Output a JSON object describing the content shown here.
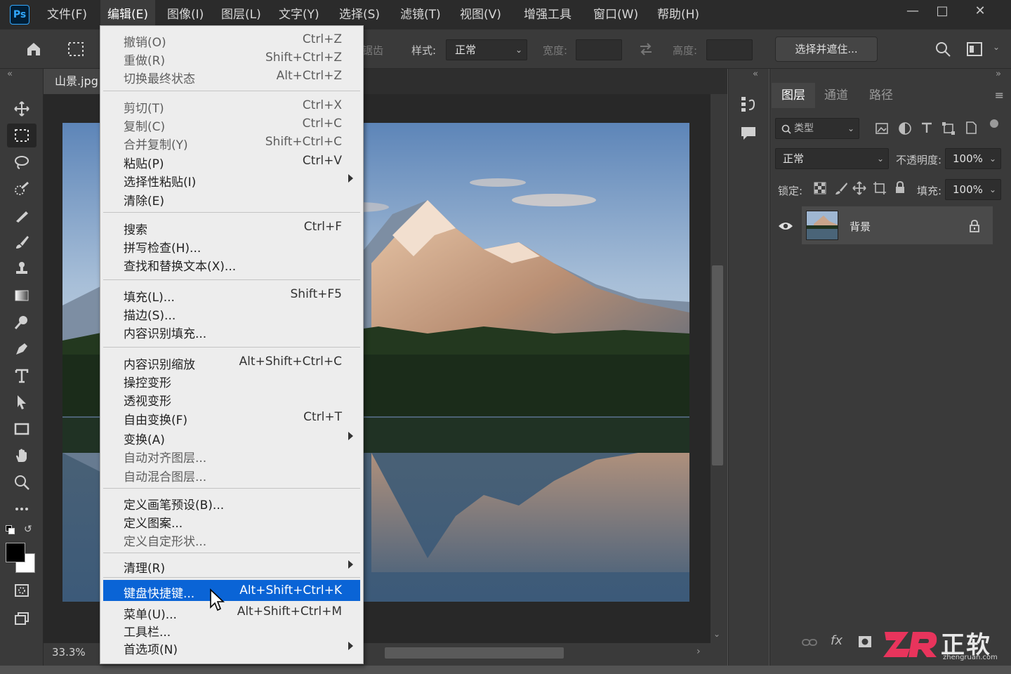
{
  "app": {
    "logo": "Ps"
  },
  "menubar": {
    "items": [
      "文件(F)",
      "编辑(E)",
      "图像(I)",
      "图层(L)",
      "文字(Y)",
      "选择(S)",
      "滤镜(T)",
      "视图(V)",
      "增强工具",
      "窗口(W)",
      "帮助(H)"
    ],
    "active_index": 1
  },
  "options_bar": {
    "style_label": "样式:",
    "style_value": "正常",
    "width_label": "宽度:",
    "height_label": "高度:",
    "partial_label": "锯齿",
    "select_mask_button": "选择并遮住..."
  },
  "document": {
    "tab_title": "山景.jpg",
    "zoom": "33.3%"
  },
  "layers_panel": {
    "tabs": [
      "图层",
      "通道",
      "路径"
    ],
    "active_tab": 0,
    "filter_placeholder": "类型",
    "blend_mode": "正常",
    "opacity_label": "不透明度:",
    "opacity_value": "100%",
    "lock_label": "锁定:",
    "fill_label": "填充:",
    "fill_value": "100%",
    "layers": [
      {
        "name": "背景",
        "locked": true,
        "visible": true
      }
    ]
  },
  "edit_menu": {
    "items": [
      {
        "label": "撤销(O)",
        "shortcut": "Ctrl+Z",
        "disabled": true
      },
      {
        "label": "重做(R)",
        "shortcut": "Shift+Ctrl+Z",
        "disabled": true
      },
      {
        "label": "切换最终状态",
        "shortcut": "Alt+Ctrl+Z",
        "disabled": true
      },
      {
        "label": "剪切(T)",
        "shortcut": "Ctrl+X",
        "disabled": true
      },
      {
        "label": "复制(C)",
        "shortcut": "Ctrl+C",
        "disabled": true
      },
      {
        "label": "合并复制(Y)",
        "shortcut": "Shift+Ctrl+C",
        "disabled": true
      },
      {
        "label": "粘贴(P)",
        "shortcut": "Ctrl+V",
        "disabled": false
      },
      {
        "label": "选择性粘贴(I)",
        "shortcut": "",
        "disabled": false,
        "submenu": true
      },
      {
        "label": "清除(E)",
        "shortcut": "",
        "disabled": false
      },
      {
        "label": "搜索",
        "shortcut": "Ctrl+F",
        "disabled": false
      },
      {
        "label": "拼写检查(H)...",
        "shortcut": "",
        "disabled": false
      },
      {
        "label": "查找和替换文本(X)...",
        "shortcut": "",
        "disabled": false
      },
      {
        "label": "填充(L)...",
        "shortcut": "Shift+F5",
        "disabled": false
      },
      {
        "label": "描边(S)...",
        "shortcut": "",
        "disabled": false
      },
      {
        "label": "内容识别填充...",
        "shortcut": "",
        "disabled": false
      },
      {
        "label": "内容识别缩放",
        "shortcut": "Alt+Shift+Ctrl+C",
        "disabled": false
      },
      {
        "label": "操控变形",
        "shortcut": "",
        "disabled": false
      },
      {
        "label": "透视变形",
        "shortcut": "",
        "disabled": false
      },
      {
        "label": "自由变换(F)",
        "shortcut": "Ctrl+T",
        "disabled": false
      },
      {
        "label": "变换(A)",
        "shortcut": "",
        "disabled": false,
        "submenu": true
      },
      {
        "label": "自动对齐图层...",
        "shortcut": "",
        "disabled": true
      },
      {
        "label": "自动混合图层...",
        "shortcut": "",
        "disabled": true
      },
      {
        "label": "定义画笔预设(B)...",
        "shortcut": "",
        "disabled": false
      },
      {
        "label": "定义图案...",
        "shortcut": "",
        "disabled": false
      },
      {
        "label": "定义自定形状...",
        "shortcut": "",
        "disabled": true
      },
      {
        "label": "清理(R)",
        "shortcut": "",
        "disabled": false,
        "submenu": true
      },
      {
        "label": "键盘快捷键...",
        "shortcut": "Alt+Shift+Ctrl+K",
        "disabled": false,
        "highlighted": true
      },
      {
        "label": "菜单(U)...",
        "shortcut": "Alt+Shift+Ctrl+M",
        "disabled": false
      },
      {
        "label": "工具栏...",
        "shortcut": "",
        "disabled": false
      },
      {
        "label": "首选项(N)",
        "shortcut": "",
        "disabled": false,
        "submenu": true
      }
    ]
  },
  "watermark": {
    "text": "正软",
    "sub": "zhengruan.com"
  },
  "colors": {
    "accent": "#0a64d6",
    "menubar": "#2b2b2b",
    "panel": "#3a3a3a",
    "canvas": "#282828"
  }
}
